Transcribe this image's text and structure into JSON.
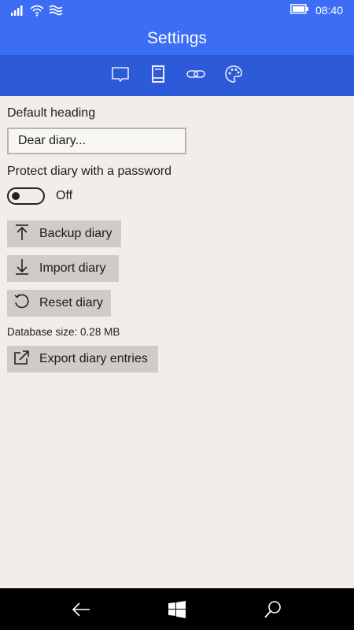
{
  "statusbar": {
    "time": "08:40",
    "icons": [
      "signal-bars-icon",
      "wifi-icon",
      "wireless-icon",
      "battery-icon"
    ]
  },
  "header": {
    "title": "Settings"
  },
  "tabs": [
    {
      "name": "comment-icon",
      "selected": false
    },
    {
      "name": "book-icon",
      "selected": true
    },
    {
      "name": "link-icon",
      "selected": false
    },
    {
      "name": "palette-icon",
      "selected": false
    }
  ],
  "settings": {
    "default_heading_label": "Default heading",
    "default_heading_value": "Dear diary...",
    "protect_label": "Protect diary with a password",
    "protect_state": "Off",
    "backup_label": "Backup diary",
    "import_label": "Import diary",
    "reset_label": "Reset diary",
    "database_size": "Database size: 0.28 MB",
    "export_label": "Export diary entries"
  },
  "colors": {
    "header_bg": "#3c6ef5",
    "tabbar_bg": "#2c5ad8",
    "page_bg": "#f1eeea",
    "button_bg": "#cfcbc7"
  },
  "navbar": {
    "icons": [
      "back-arrow-icon",
      "windows-logo-icon",
      "search-icon"
    ]
  }
}
